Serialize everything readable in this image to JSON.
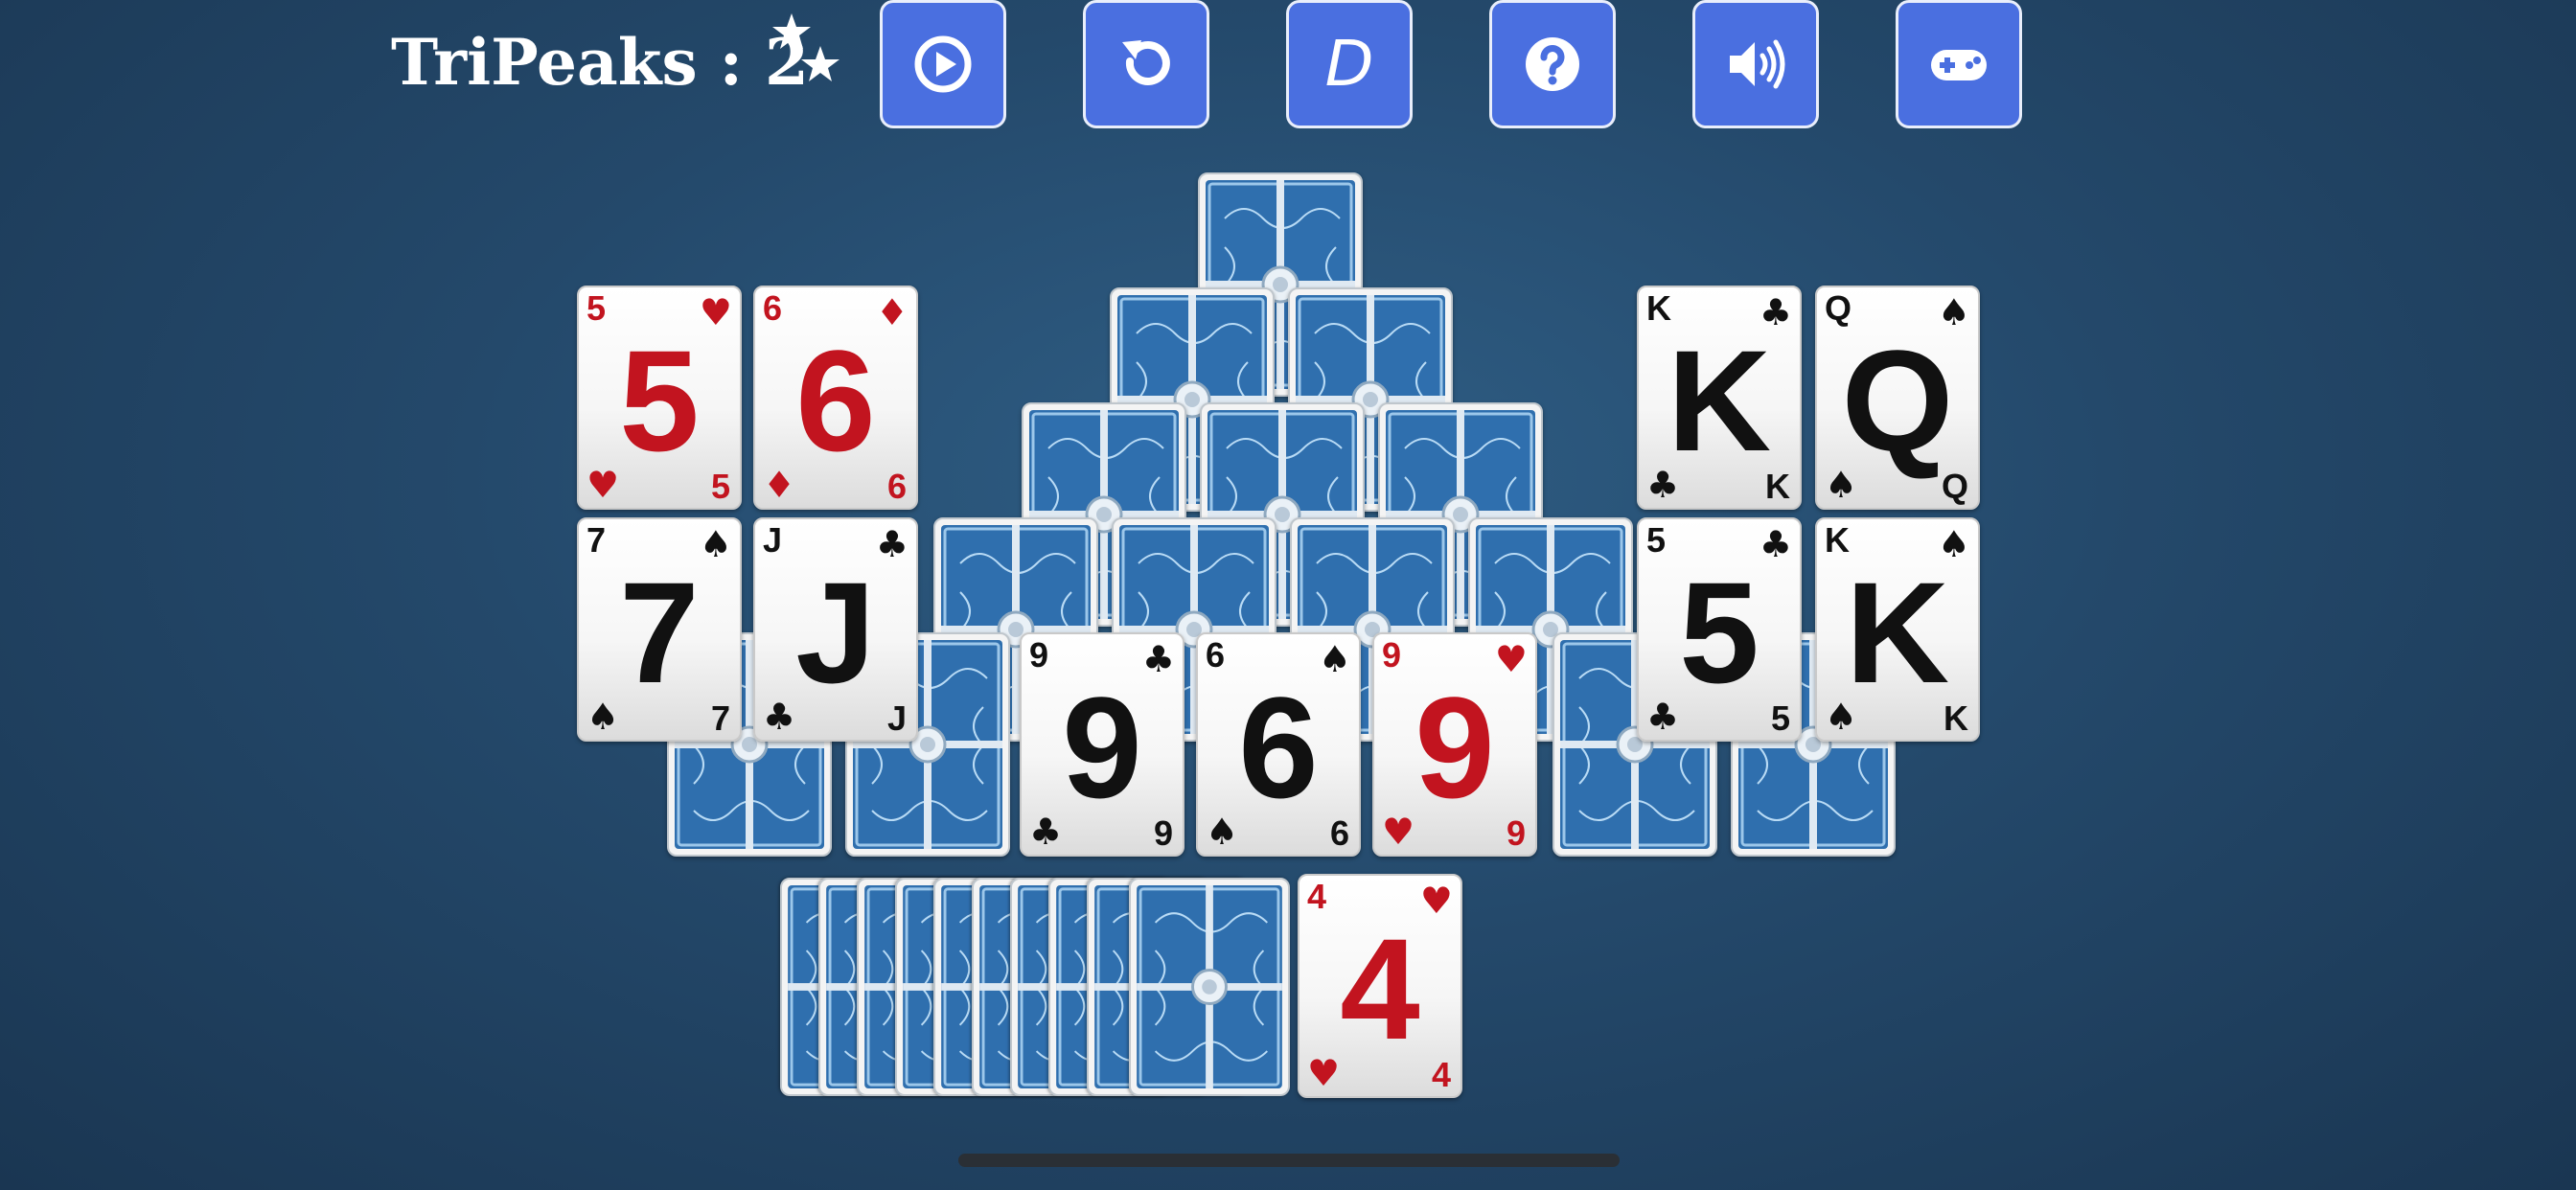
{
  "game": {
    "name": "TriPeaks",
    "level_label": "TriPeaks : 2"
  },
  "toolbar": [
    {
      "id": "play",
      "icon": "play-circle-icon"
    },
    {
      "id": "undo",
      "icon": "undo-icon"
    },
    {
      "id": "deal",
      "icon": "deal-d-icon",
      "label": "D"
    },
    {
      "id": "help",
      "icon": "question-circle-icon"
    },
    {
      "id": "sound",
      "icon": "speaker-icon"
    },
    {
      "id": "games",
      "icon": "gamepad-icon"
    }
  ],
  "cards": {
    "c5h": {
      "rank": "5",
      "suit": "♥",
      "color": "red"
    },
    "c6d": {
      "rank": "6",
      "suit": "♦",
      "color": "red"
    },
    "c7s": {
      "rank": "7",
      "suit": "♠",
      "color": "black"
    },
    "cjc": {
      "rank": "J",
      "suit": "♣",
      "color": "black"
    },
    "c9c": {
      "rank": "9",
      "suit": "♣",
      "color": "black"
    },
    "c6s": {
      "rank": "6",
      "suit": "♠",
      "color": "black"
    },
    "c9h": {
      "rank": "9",
      "suit": "♥",
      "color": "red"
    },
    "ckc": {
      "rank": "K",
      "suit": "♣",
      "color": "black"
    },
    "cqs": {
      "rank": "Q",
      "suit": "♠",
      "color": "black"
    },
    "c5c": {
      "rank": "5",
      "suit": "♣",
      "color": "black"
    },
    "cks": {
      "rank": "K",
      "suit": "♠",
      "color": "black"
    },
    "waste": {
      "rank": "4",
      "suit": "♥",
      "color": "red"
    }
  },
  "stock": {
    "count": 10
  },
  "colors": {
    "button": "#4a6fe0",
    "card_back": "#3a78b8",
    "red_suit": "#c2141f",
    "black_suit": "#111111"
  }
}
